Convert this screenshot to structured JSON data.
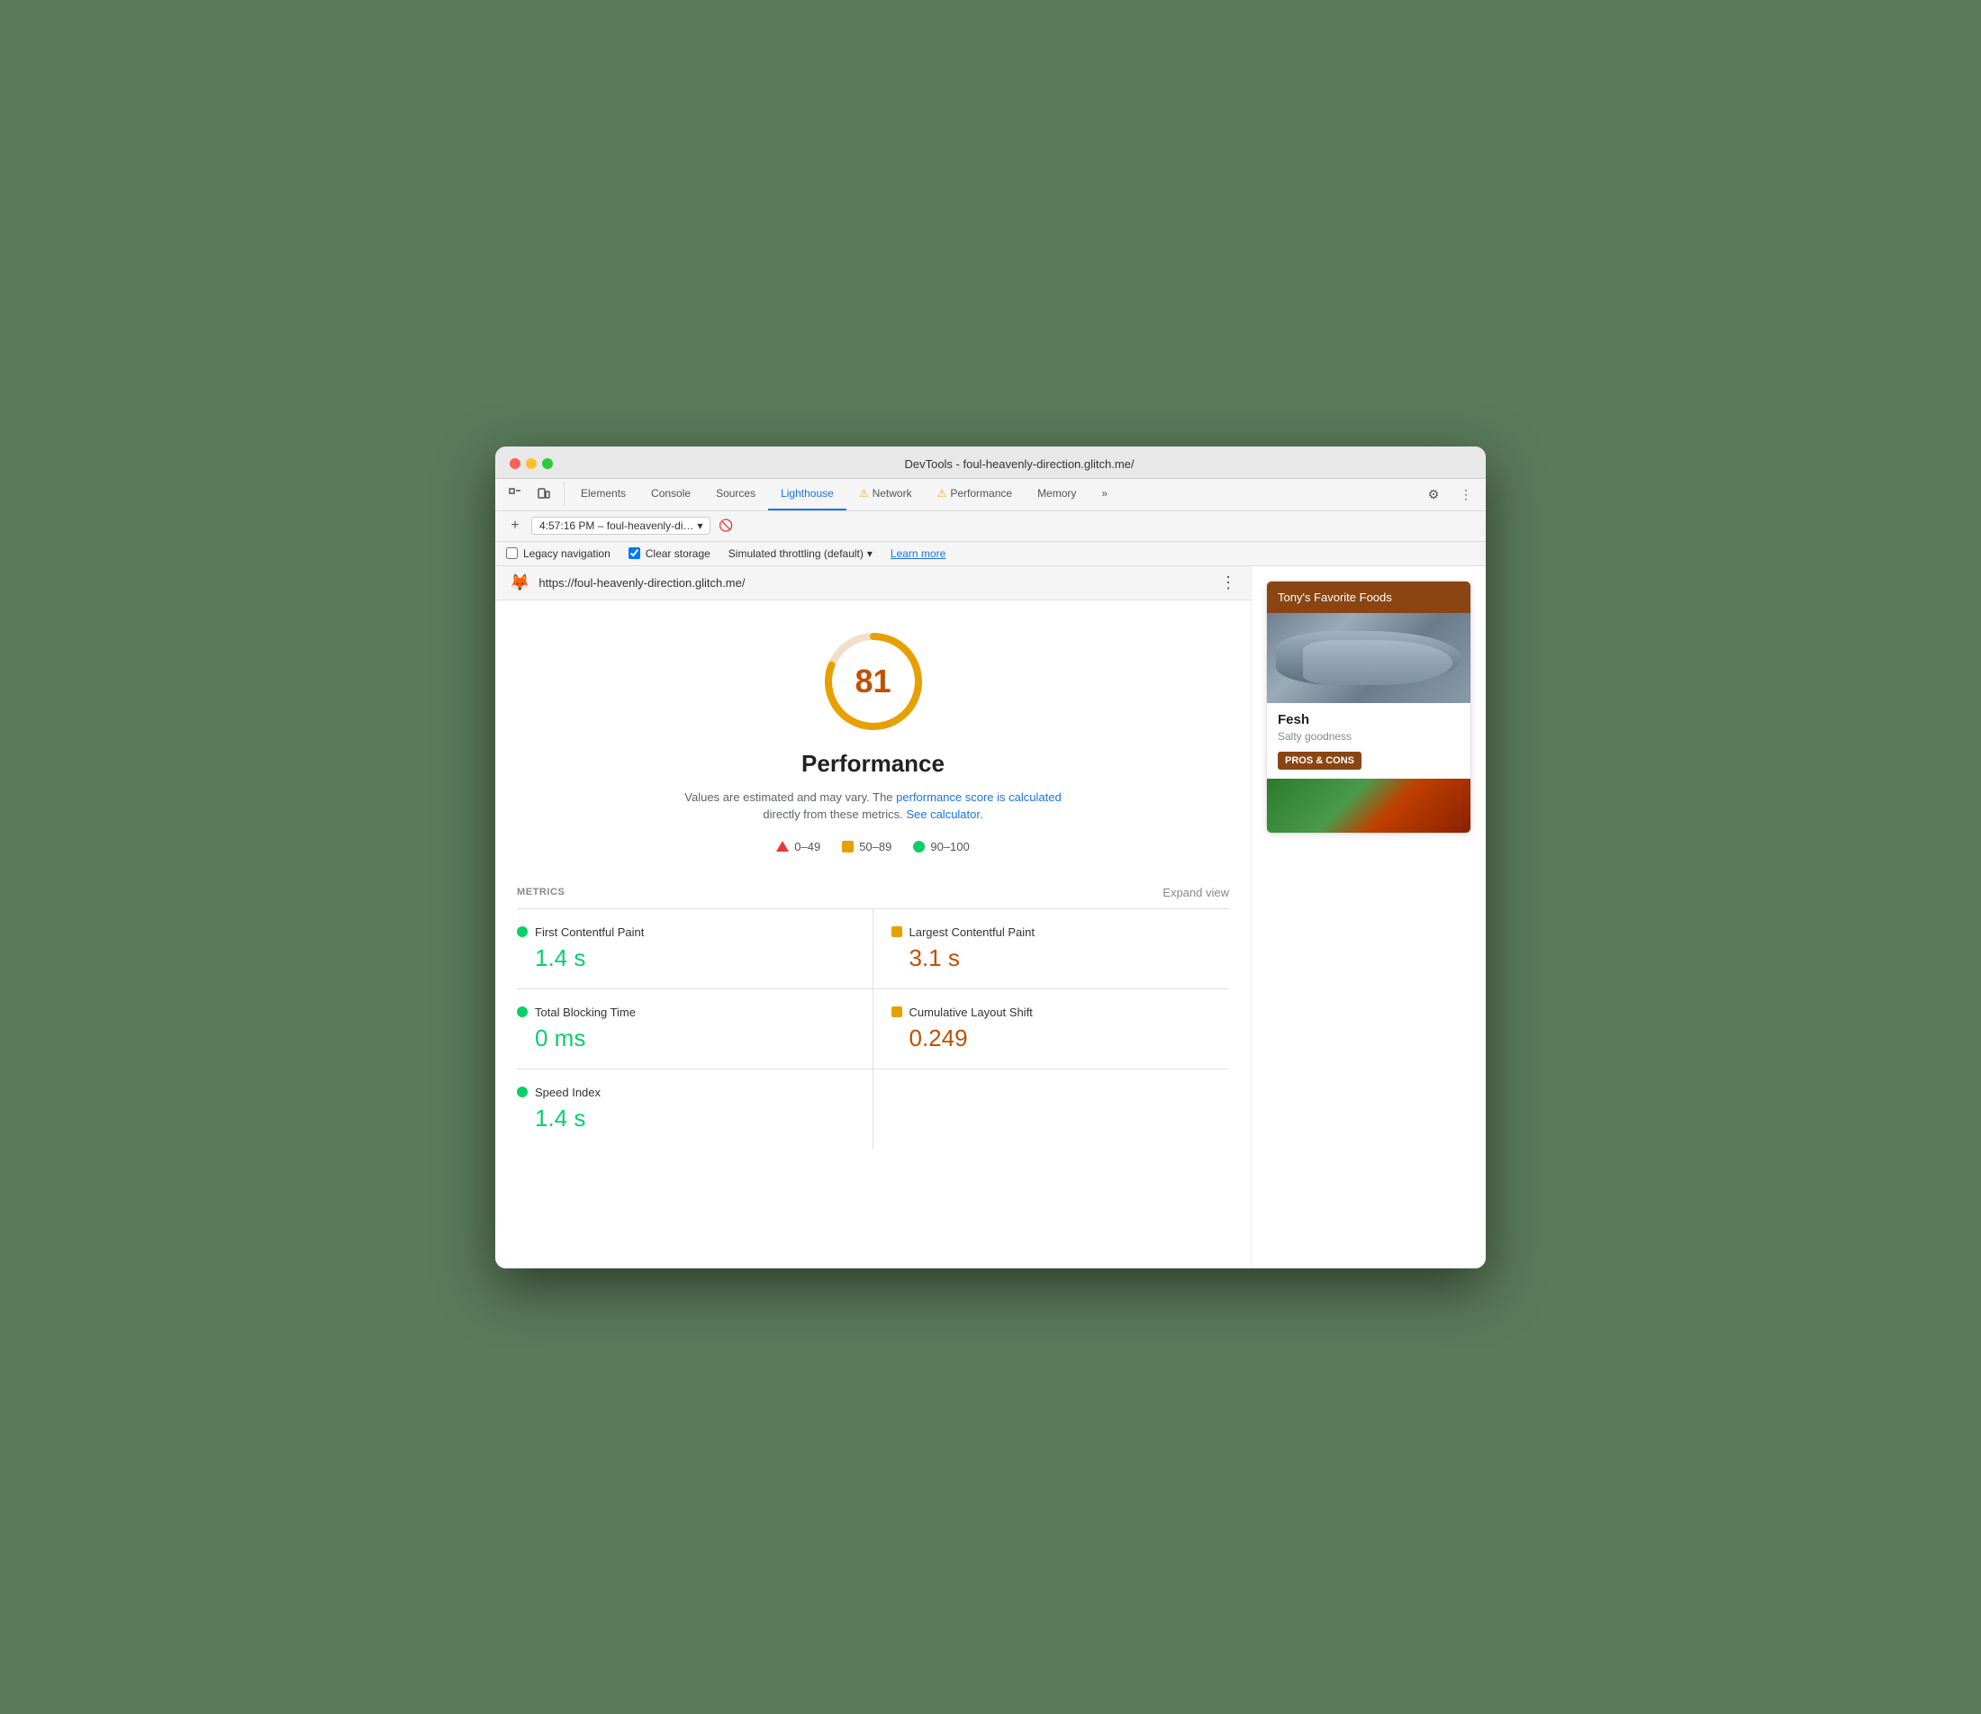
{
  "window": {
    "title": "DevTools - foul-heavenly-direction.glitch.me/"
  },
  "tabs": {
    "items": [
      {
        "id": "elements",
        "label": "Elements",
        "active": false,
        "warning": false
      },
      {
        "id": "console",
        "label": "Console",
        "active": false,
        "warning": false
      },
      {
        "id": "sources",
        "label": "Sources",
        "active": false,
        "warning": false
      },
      {
        "id": "lighthouse",
        "label": "Lighthouse",
        "active": true,
        "warning": false
      },
      {
        "id": "network",
        "label": "Network",
        "active": false,
        "warning": true
      },
      {
        "id": "performance",
        "label": "Performance",
        "active": false,
        "warning": true
      },
      {
        "id": "memory",
        "label": "Memory",
        "active": false,
        "warning": false
      }
    ]
  },
  "session": {
    "label": "4:57:16 PM – foul-heavenly-di…",
    "dropdown_icon": "▾"
  },
  "options": {
    "legacy_navigation_label": "Legacy navigation",
    "legacy_navigation_checked": false,
    "clear_storage_label": "Clear storage",
    "clear_storage_checked": true,
    "throttling_label": "Simulated throttling (default)",
    "throttling_dropdown": "▾",
    "learn_more_label": "Learn more"
  },
  "url_bar": {
    "icon": "🦊",
    "url": "https://foul-heavenly-direction.glitch.me/",
    "more_icon": "⋮"
  },
  "score": {
    "value": "81",
    "title": "Performance",
    "description_text": "Values are estimated and may vary. The",
    "performance_score_link": "performance score is calculated",
    "description_mid": "directly from these metrics.",
    "calculator_link": "See calculator.",
    "circle_percent": 81
  },
  "legend": {
    "items": [
      {
        "id": "bad",
        "type": "triangle",
        "label": "0–49"
      },
      {
        "id": "medium",
        "type": "square",
        "label": "50–89"
      },
      {
        "id": "good",
        "type": "circle",
        "label": "90–100"
      }
    ]
  },
  "metrics": {
    "label": "METRICS",
    "expand_label": "Expand view",
    "items": [
      {
        "id": "fcp",
        "name": "First Contentful Paint",
        "value": "1.4 s",
        "status": "green",
        "col": "left"
      },
      {
        "id": "lcp",
        "name": "Largest Contentful Paint",
        "value": "3.1 s",
        "status": "orange",
        "col": "right"
      },
      {
        "id": "tbt",
        "name": "Total Blocking Time",
        "value": "0 ms",
        "status": "green",
        "col": "left"
      },
      {
        "id": "cls",
        "name": "Cumulative Layout Shift",
        "value": "0.249",
        "status": "orange",
        "col": "right"
      },
      {
        "id": "si",
        "name": "Speed Index",
        "value": "1.4 s",
        "status": "green",
        "col": "left"
      }
    ]
  },
  "preview": {
    "header": "Tony's Favorite Foods",
    "food_name": "Fesh",
    "food_desc": "Salty goodness",
    "button_label": "PROS & CONS"
  }
}
